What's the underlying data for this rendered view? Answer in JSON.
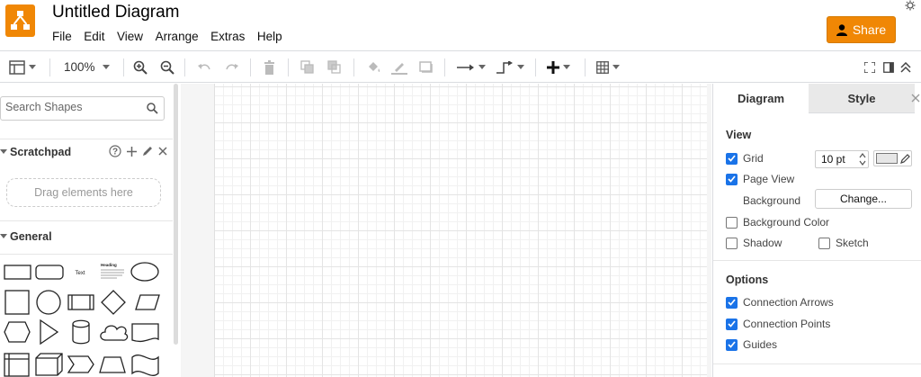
{
  "app": {
    "title": "Untitled Diagram",
    "share_label": "Share",
    "accent_color": "#f08705",
    "logo_icon": "drawio-logo-icon"
  },
  "menu": {
    "items": [
      "File",
      "Edit",
      "View",
      "Arrange",
      "Extras",
      "Help"
    ]
  },
  "toolbar": {
    "zoom": "100%",
    "icons": [
      "format-panel-icon",
      "zoom-in-icon",
      "zoom-out-icon",
      "undo-icon",
      "redo-icon",
      "delete-icon",
      "to-front-icon",
      "to-back-icon",
      "fill-color-icon",
      "line-color-icon",
      "shadow-icon",
      "connection-icon",
      "waypoints-icon",
      "insert-icon",
      "table-icon",
      "fullscreen-icon",
      "toggle-panel-icon",
      "collapse-icon"
    ]
  },
  "left_panel": {
    "search_placeholder": "Search Shapes",
    "scratchpad_label": "Scratchpad",
    "drag_hint": "Drag elements here",
    "general_label": "General",
    "shapes_row1_labels": [
      "Text",
      "Heading"
    ]
  },
  "right_panel": {
    "tabs": [
      "Diagram",
      "Style"
    ],
    "view_title": "View",
    "grid": {
      "label": "Grid",
      "checked": true,
      "size": "10 pt"
    },
    "page_view": {
      "label": "Page View",
      "checked": true
    },
    "background": {
      "label": "Background",
      "button": "Change..."
    },
    "background_color": {
      "label": "Background Color",
      "checked": false
    },
    "shadow": {
      "label": "Shadow",
      "checked": false
    },
    "sketch": {
      "label": "Sketch",
      "checked": false
    },
    "options_title": "Options",
    "connection_arrows": {
      "label": "Connection Arrows",
      "checked": true
    },
    "connection_points": {
      "label": "Connection Points",
      "checked": true
    },
    "guides": {
      "label": "Guides",
      "checked": true
    }
  }
}
